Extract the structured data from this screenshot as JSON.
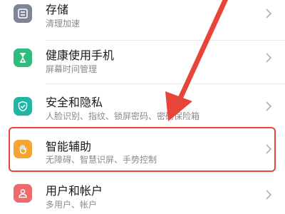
{
  "colors": {
    "highlight": "#e8453a",
    "storage_icon_bg": "#7d8596",
    "health_icon_bg": "#2ebd7e",
    "security_icon_bg": "#1fb6a6",
    "assist_icon_bg": "#f5a431",
    "users_icon_bg": "#ef6a6a"
  },
  "settings": {
    "items": [
      {
        "title": "存储",
        "subtitle": "清理加速",
        "icon": "storage-icon"
      },
      {
        "title": "健康使用手机",
        "subtitle": "屏幕时间管理",
        "icon": "hourglass-icon"
      },
      {
        "title": "安全和隐私",
        "subtitle": "人脸识别、指纹、锁屏密码、密码保险箱",
        "icon": "shield-check-icon"
      },
      {
        "title": "智能辅助",
        "subtitle": "无障碍、智慧识屏、手势控制",
        "icon": "hand-icon"
      },
      {
        "title": "用户和帐户",
        "subtitle": "多用户、帐户",
        "icon": "user-icon"
      }
    ]
  }
}
